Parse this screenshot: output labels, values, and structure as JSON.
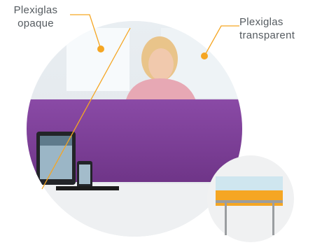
{
  "labels": {
    "opaque": {
      "line1": "Plexiglas",
      "line2": "opaque"
    },
    "transparent": {
      "line1": "Plexiglas",
      "line2": "transparent"
    }
  },
  "colors": {
    "accent": "#f5a623",
    "panel": "#7b3f97",
    "label_text": "#555b60",
    "screen_top": "#cfe6ef",
    "leg": "#9a9da0"
  },
  "icons": {
    "inset": "desk-screen-icon"
  }
}
